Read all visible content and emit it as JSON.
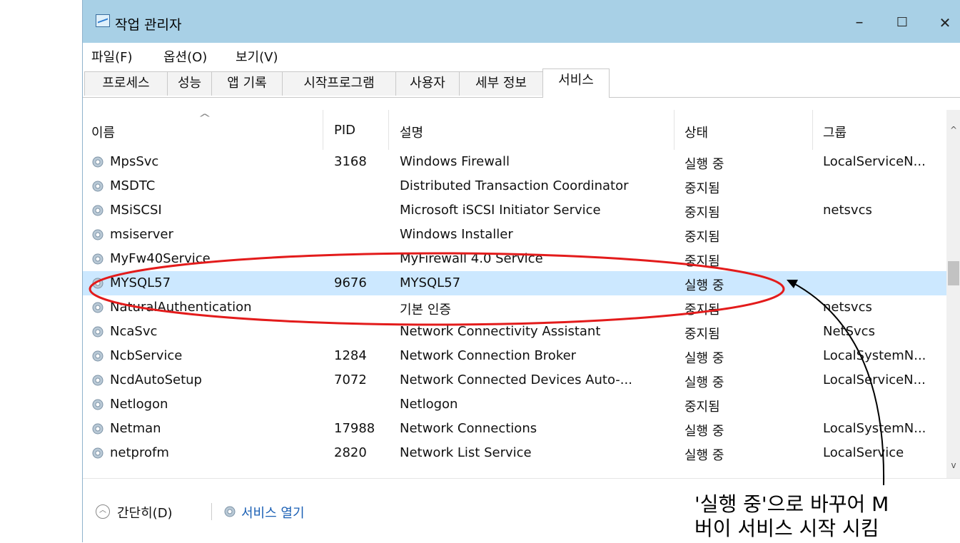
{
  "window": {
    "title": "작업 관리자",
    "controls": {
      "minimize": "–",
      "maximize": "☐",
      "close": "✕"
    }
  },
  "menu": [
    "파일(F)",
    "옵션(O)",
    "보기(V)"
  ],
  "tabs": [
    {
      "label": "프로세스",
      "active": false
    },
    {
      "label": "성능",
      "active": false
    },
    {
      "label": "앱 기록",
      "active": false
    },
    {
      "label": "시작프로그램",
      "active": false
    },
    {
      "label": "사용자",
      "active": false
    },
    {
      "label": "세부 정보",
      "active": false
    },
    {
      "label": "서비스",
      "active": true
    }
  ],
  "table": {
    "columns": [
      "이름",
      "PID",
      "설명",
      "상태",
      "그룹"
    ],
    "sort_indicator": "^",
    "rows": [
      {
        "name": "MpsSvc",
        "pid": "3168",
        "desc": "Windows Firewall",
        "status": "실행 중",
        "group": "LocalServiceN..."
      },
      {
        "name": "MSDTC",
        "pid": "",
        "desc": "Distributed Transaction Coordinator",
        "status": "중지됨",
        "group": ""
      },
      {
        "name": "MSiSCSI",
        "pid": "",
        "desc": "Microsoft iSCSI Initiator Service",
        "status": "중지됨",
        "group": "netsvcs"
      },
      {
        "name": "msiserver",
        "pid": "",
        "desc": "Windows Installer",
        "status": "중지됨",
        "group": ""
      },
      {
        "name": "MyFw40Service",
        "pid": "",
        "desc": "MyFirewall 4.0 Service",
        "status": "중지됨",
        "group": ""
      },
      {
        "name": "MYSQL57",
        "pid": "9676",
        "desc": "MYSQL57",
        "status": "실행 중",
        "group": "",
        "selected": true
      },
      {
        "name": "NaturalAuthentication",
        "pid": "",
        "desc": "기본 인증",
        "status": "중지됨",
        "group": "netsvcs"
      },
      {
        "name": "NcaSvc",
        "pid": "",
        "desc": "Network Connectivity Assistant",
        "status": "중지됨",
        "group": "NetSvcs"
      },
      {
        "name": "NcbService",
        "pid": "1284",
        "desc": "Network Connection Broker",
        "status": "실행 중",
        "group": "LocalSystemN..."
      },
      {
        "name": "NcdAutoSetup",
        "pid": "7072",
        "desc": "Network Connected Devices Auto-...",
        "status": "실행 중",
        "group": "LocalServiceN..."
      },
      {
        "name": "Netlogon",
        "pid": "",
        "desc": "Netlogon",
        "status": "중지됨",
        "group": ""
      },
      {
        "name": "Netman",
        "pid": "17988",
        "desc": "Network Connections",
        "status": "실행 중",
        "group": "LocalSystemN..."
      },
      {
        "name": "netprofm",
        "pid": "2820",
        "desc": "Network List Service",
        "status": "실행 중",
        "group": "LocalService"
      }
    ]
  },
  "footer": {
    "collapse_label": "간단히(D)",
    "open_services_label": "서비스 열기"
  },
  "annotation": {
    "line1": "'실행 중'으로 바꾸어 M",
    "line2": "버이 서비스 시작 시킴"
  },
  "colors": {
    "title_bar": "#a8d0e6",
    "selected_row": "#cce8ff",
    "annotation_ellipse": "#e31b1b",
    "link_text": "#1a5fb4"
  },
  "icons": {
    "app": "task-manager-icon",
    "service": "gear-icon",
    "collapse": "chevron-up-circle-icon"
  }
}
